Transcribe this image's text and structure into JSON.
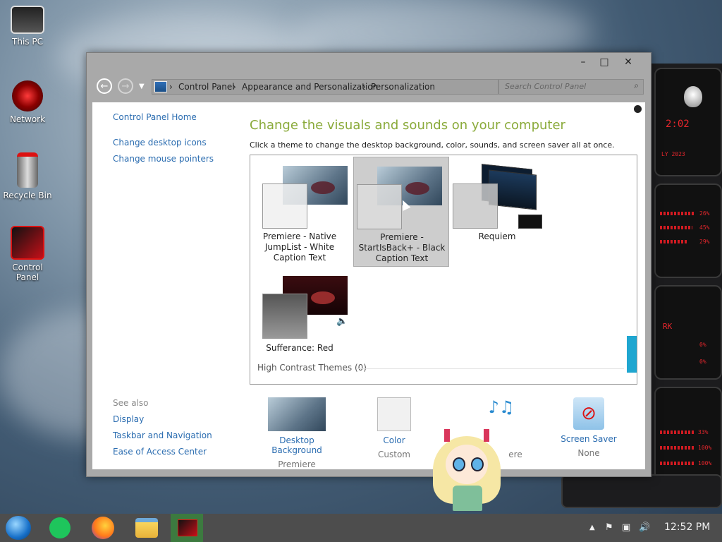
{
  "desktop": {
    "icons": [
      {
        "label": "This PC",
        "icon": "computer-icon"
      },
      {
        "label": "Network",
        "icon": "network-icon"
      },
      {
        "label": "Recycle Bin",
        "icon": "recycle-bin-icon"
      },
      {
        "label": "Control Panel",
        "icon": "control-panel-icon"
      }
    ]
  },
  "window": {
    "controls": {
      "minimize": "–",
      "maximize": "□",
      "close": "✕"
    },
    "breadcrumb": [
      "Control Panel",
      "Appearance and Personalization",
      "Personalization"
    ],
    "search_placeholder": "Search Control Panel",
    "sidebar": {
      "home": "Control Panel Home",
      "links": [
        "Change desktop icons",
        "Change mouse pointers"
      ],
      "see_also_title": "See also",
      "see_also": [
        "Display",
        "Taskbar and Navigation",
        "Ease of Access Center"
      ]
    },
    "heading": "Change the visuals and sounds on your computer",
    "subheading": "Click a theme to change the desktop background, color, sounds, and screen saver all at once.",
    "themes": [
      {
        "name": "Premiere - Native JumpList - White Caption Text",
        "selected": false
      },
      {
        "name": "Premiere - StartIsBack+ - Black Caption Text",
        "selected": true
      },
      {
        "name": "Requiem",
        "selected": false
      },
      {
        "name": "Sufferance: Red",
        "selected": false
      }
    ],
    "high_contrast": "High Contrast Themes (0)",
    "bottom": [
      {
        "label": "Desktop Background",
        "value": "Premiere"
      },
      {
        "label": "Color",
        "value": "Custom"
      },
      {
        "label": "",
        "value": "ere"
      },
      {
        "label": "Screen Saver",
        "value": "None"
      }
    ]
  },
  "widget": {
    "clock": "2:02",
    "date": "LY 2023",
    "readouts": [
      "26%",
      "45%",
      "29%",
      "0%",
      "0%",
      "33%",
      "100%",
      "100%"
    ],
    "label": "RK"
  },
  "taskbar": {
    "time": "12:52 PM",
    "pinned": [
      "start-orb-icon",
      "notes-icon",
      "firefox-icon",
      "file-explorer-icon",
      "control-panel-icon"
    ]
  },
  "colors": {
    "accent_green": "#8aaa3a",
    "link_blue": "#2a6cb0",
    "scroll_blue": "#1fa6d0",
    "widget_red": "#e4262c"
  }
}
